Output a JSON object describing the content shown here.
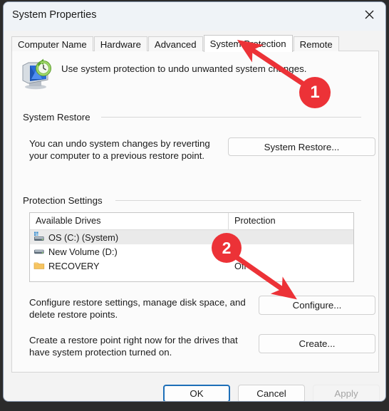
{
  "window": {
    "title": "System Properties",
    "close_icon": "close-icon"
  },
  "tabs": [
    {
      "label": "Computer Name",
      "active": false
    },
    {
      "label": "Hardware",
      "active": false
    },
    {
      "label": "Advanced",
      "active": false
    },
    {
      "label": "System Protection",
      "active": true
    },
    {
      "label": "Remote",
      "active": false
    }
  ],
  "header": {
    "icon": "system-protection-icon",
    "text": "Use system protection to undo unwanted system changes."
  },
  "groups": {
    "system_restore": {
      "label": "System Restore",
      "description": "You can undo system changes by reverting your computer to a previous restore point.",
      "button": "System Restore..."
    },
    "protection_settings": {
      "label": "Protection Settings",
      "columns": [
        "Available Drives",
        "Protection"
      ],
      "rows": [
        {
          "icon": "system-drive-icon",
          "drive": "OS (C:) (System)",
          "protection": "",
          "selected": true
        },
        {
          "icon": "hard-drive-icon",
          "drive": "New Volume (D:)",
          "protection": "",
          "selected": false
        },
        {
          "icon": "folder-icon",
          "drive": "RECOVERY",
          "protection": "Off",
          "selected": false
        }
      ],
      "configure_description": "Configure restore settings, manage disk space, and delete restore points.",
      "configure_button": "Configure...",
      "create_description": "Create a restore point right now for the drives that have system protection turned on.",
      "create_button": "Create..."
    }
  },
  "footer": {
    "ok": "OK",
    "cancel": "Cancel",
    "apply": "Apply"
  },
  "annotations": {
    "color": "#ec3237",
    "badges": [
      {
        "label": "1"
      },
      {
        "label": "2"
      }
    ]
  }
}
